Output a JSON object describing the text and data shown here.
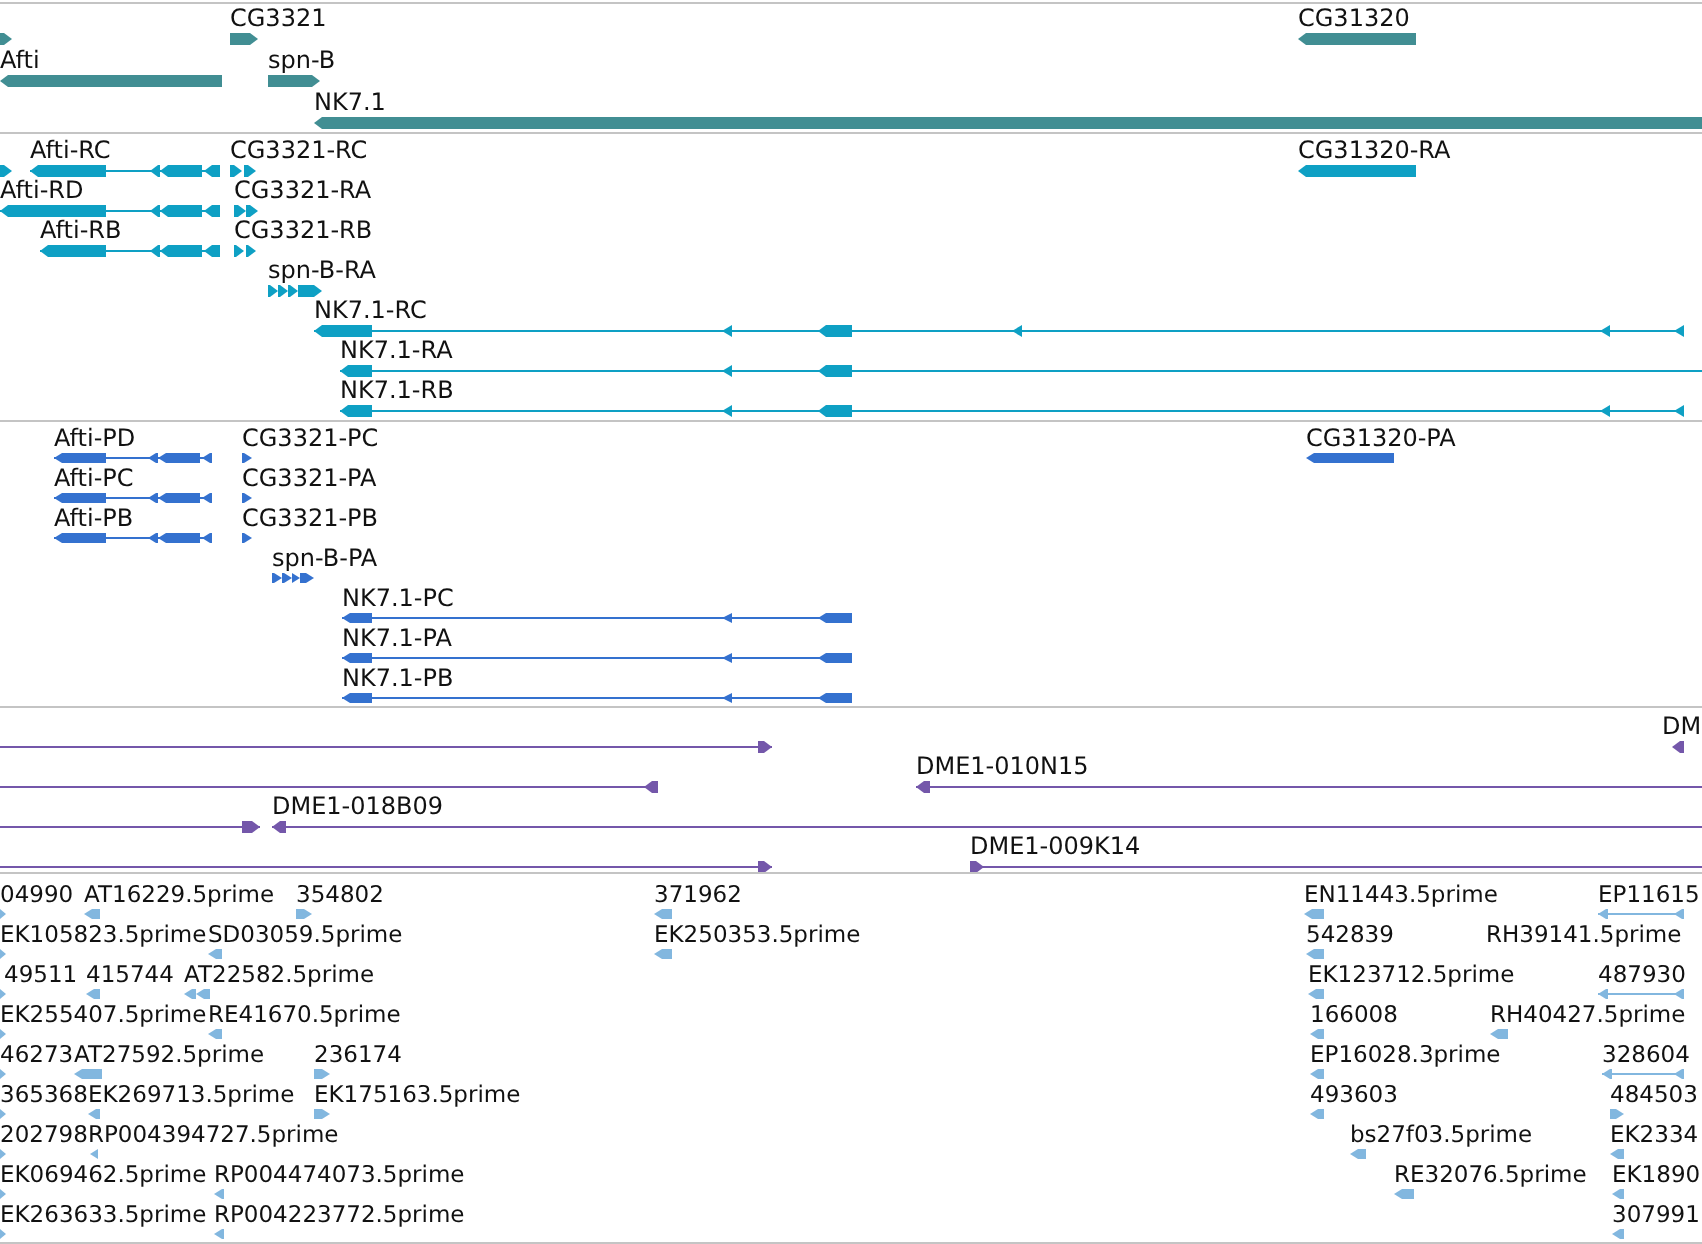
{
  "tracks": [
    {
      "kind": "gene",
      "features": [
        {
          "reverse": false
        },
        {
          "label": "CG3321",
          "reverse": false
        },
        {
          "label": "CG31320",
          "reverse": true
        },
        {
          "label": "Afti",
          "reverse": true
        },
        {
          "label": "spn-B",
          "reverse": false
        },
        {
          "label": "NK7.1",
          "reverse": true
        }
      ]
    },
    {
      "kind": "transcript",
      "features": [
        {
          "reverse": false
        },
        {
          "label": "Afti-RC",
          "reverse": true
        },
        {
          "label": "CG3321-RC",
          "reverse": false
        },
        {
          "label": "CG31320-RA",
          "reverse": true
        },
        {
          "label": "Afti-RD",
          "reverse": true
        },
        {
          "label": "CG3321-RA",
          "reverse": false
        },
        {
          "label": "Afti-RB",
          "reverse": true
        },
        {
          "label": "CG3321-RB",
          "reverse": false
        },
        {
          "label": "spn-B-RA",
          "reverse": false
        },
        {
          "label": "NK7.1-RC",
          "reverse": true
        },
        {
          "label": "NK7.1-RA",
          "reverse": true
        },
        {
          "label": "NK7.1-RB",
          "reverse": true
        }
      ]
    },
    {
      "kind": "protein",
      "features": [
        {
          "label": "Afti-PD",
          "reverse": true
        },
        {
          "label": "CG3321-PC",
          "reverse": false
        },
        {
          "label": "CG31320-PA",
          "reverse": true
        },
        {
          "label": "Afti-PC",
          "reverse": true
        },
        {
          "label": "CG3321-PA",
          "reverse": false
        },
        {
          "label": "Afti-PB",
          "reverse": true
        },
        {
          "label": "CG3321-PB",
          "reverse": false
        },
        {
          "label": "spn-B-PA",
          "reverse": false
        },
        {
          "label": "NK7.1-PC",
          "reverse": true
        },
        {
          "label": "NK7.1-PA",
          "reverse": true
        },
        {
          "label": "NK7.1-PB",
          "reverse": true
        }
      ]
    },
    {
      "kind": "clone",
      "features": [
        {
          "reverse": false
        },
        {
          "label": "DM",
          "reverse": true
        },
        {
          "reverse": true
        },
        {
          "label": "DME1-010N15",
          "reverse": true
        },
        {
          "reverse": false
        },
        {
          "label": "DME1-018B09",
          "reverse": true
        },
        {
          "reverse": false
        },
        {
          "label": "DME1-009K14",
          "reverse": false
        }
      ]
    },
    {
      "kind": "est",
      "features": [
        {
          "label": "04990",
          "reverse": false
        },
        {
          "label": "AT16229.5prime",
          "reverse": true
        },
        {
          "label": "354802",
          "reverse": false
        },
        {
          "label": "371962",
          "reverse": true
        },
        {
          "label": "EN11443.5prime",
          "reverse": true
        },
        {
          "label": "EP11615",
          "reverse": true
        },
        {
          "label": "EK105823.5prime",
          "reverse": false
        },
        {
          "label": "SD03059.5prime",
          "reverse": true
        },
        {
          "label": "EK250353.5prime",
          "reverse": true
        },
        {
          "label": "542839",
          "reverse": true
        },
        {
          "label": "RH39141.5prime"
        },
        {
          "label": "49511",
          "reverse": false
        },
        {
          "label": "415744",
          "reverse": true
        },
        {
          "label": "AT22582.5prime",
          "reverse": true
        },
        {
          "label": "EK123712.5prime",
          "reverse": true
        },
        {
          "label": "487930",
          "reverse": true
        },
        {
          "label": "EK255407.5prime",
          "reverse": false
        },
        {
          "label": "RE41670.5prime",
          "reverse": true
        },
        {
          "label": "166008",
          "reverse": true
        },
        {
          "label": "RH40427.5prime",
          "reverse": true
        },
        {
          "label": "46273",
          "reverse": false
        },
        {
          "label": "AT27592.5prime",
          "reverse": true
        },
        {
          "label": "236174",
          "reverse": false
        },
        {
          "label": "EP16028.3prime",
          "reverse": true
        },
        {
          "label": "328604",
          "reverse": true
        },
        {
          "label": "365368",
          "reverse": false
        },
        {
          "label": "EK269713.5prime",
          "reverse": true
        },
        {
          "label": "EK175163.5prime",
          "reverse": false
        },
        {
          "label": "493603",
          "reverse": true
        },
        {
          "label": "484503",
          "reverse": false
        },
        {
          "label": "202798",
          "reverse": false
        },
        {
          "label": "RP004394727.5prime",
          "reverse": true
        },
        {
          "label": "bs27f03.5prime",
          "reverse": true
        },
        {
          "label": "EK2334",
          "reverse": true
        },
        {
          "label": "EK069462.5prime",
          "reverse": false
        },
        {
          "label": "RP004474073.5prime",
          "reverse": true
        },
        {
          "label": "RE32076.5prime",
          "reverse": true
        },
        {
          "label": "EK1890",
          "reverse": true
        },
        {
          "label": "EK263633.5prime",
          "reverse": false
        },
        {
          "label": "RP004223772.5prime",
          "reverse": true
        },
        {
          "label": "307991",
          "reverse": true
        }
      ]
    }
  ]
}
